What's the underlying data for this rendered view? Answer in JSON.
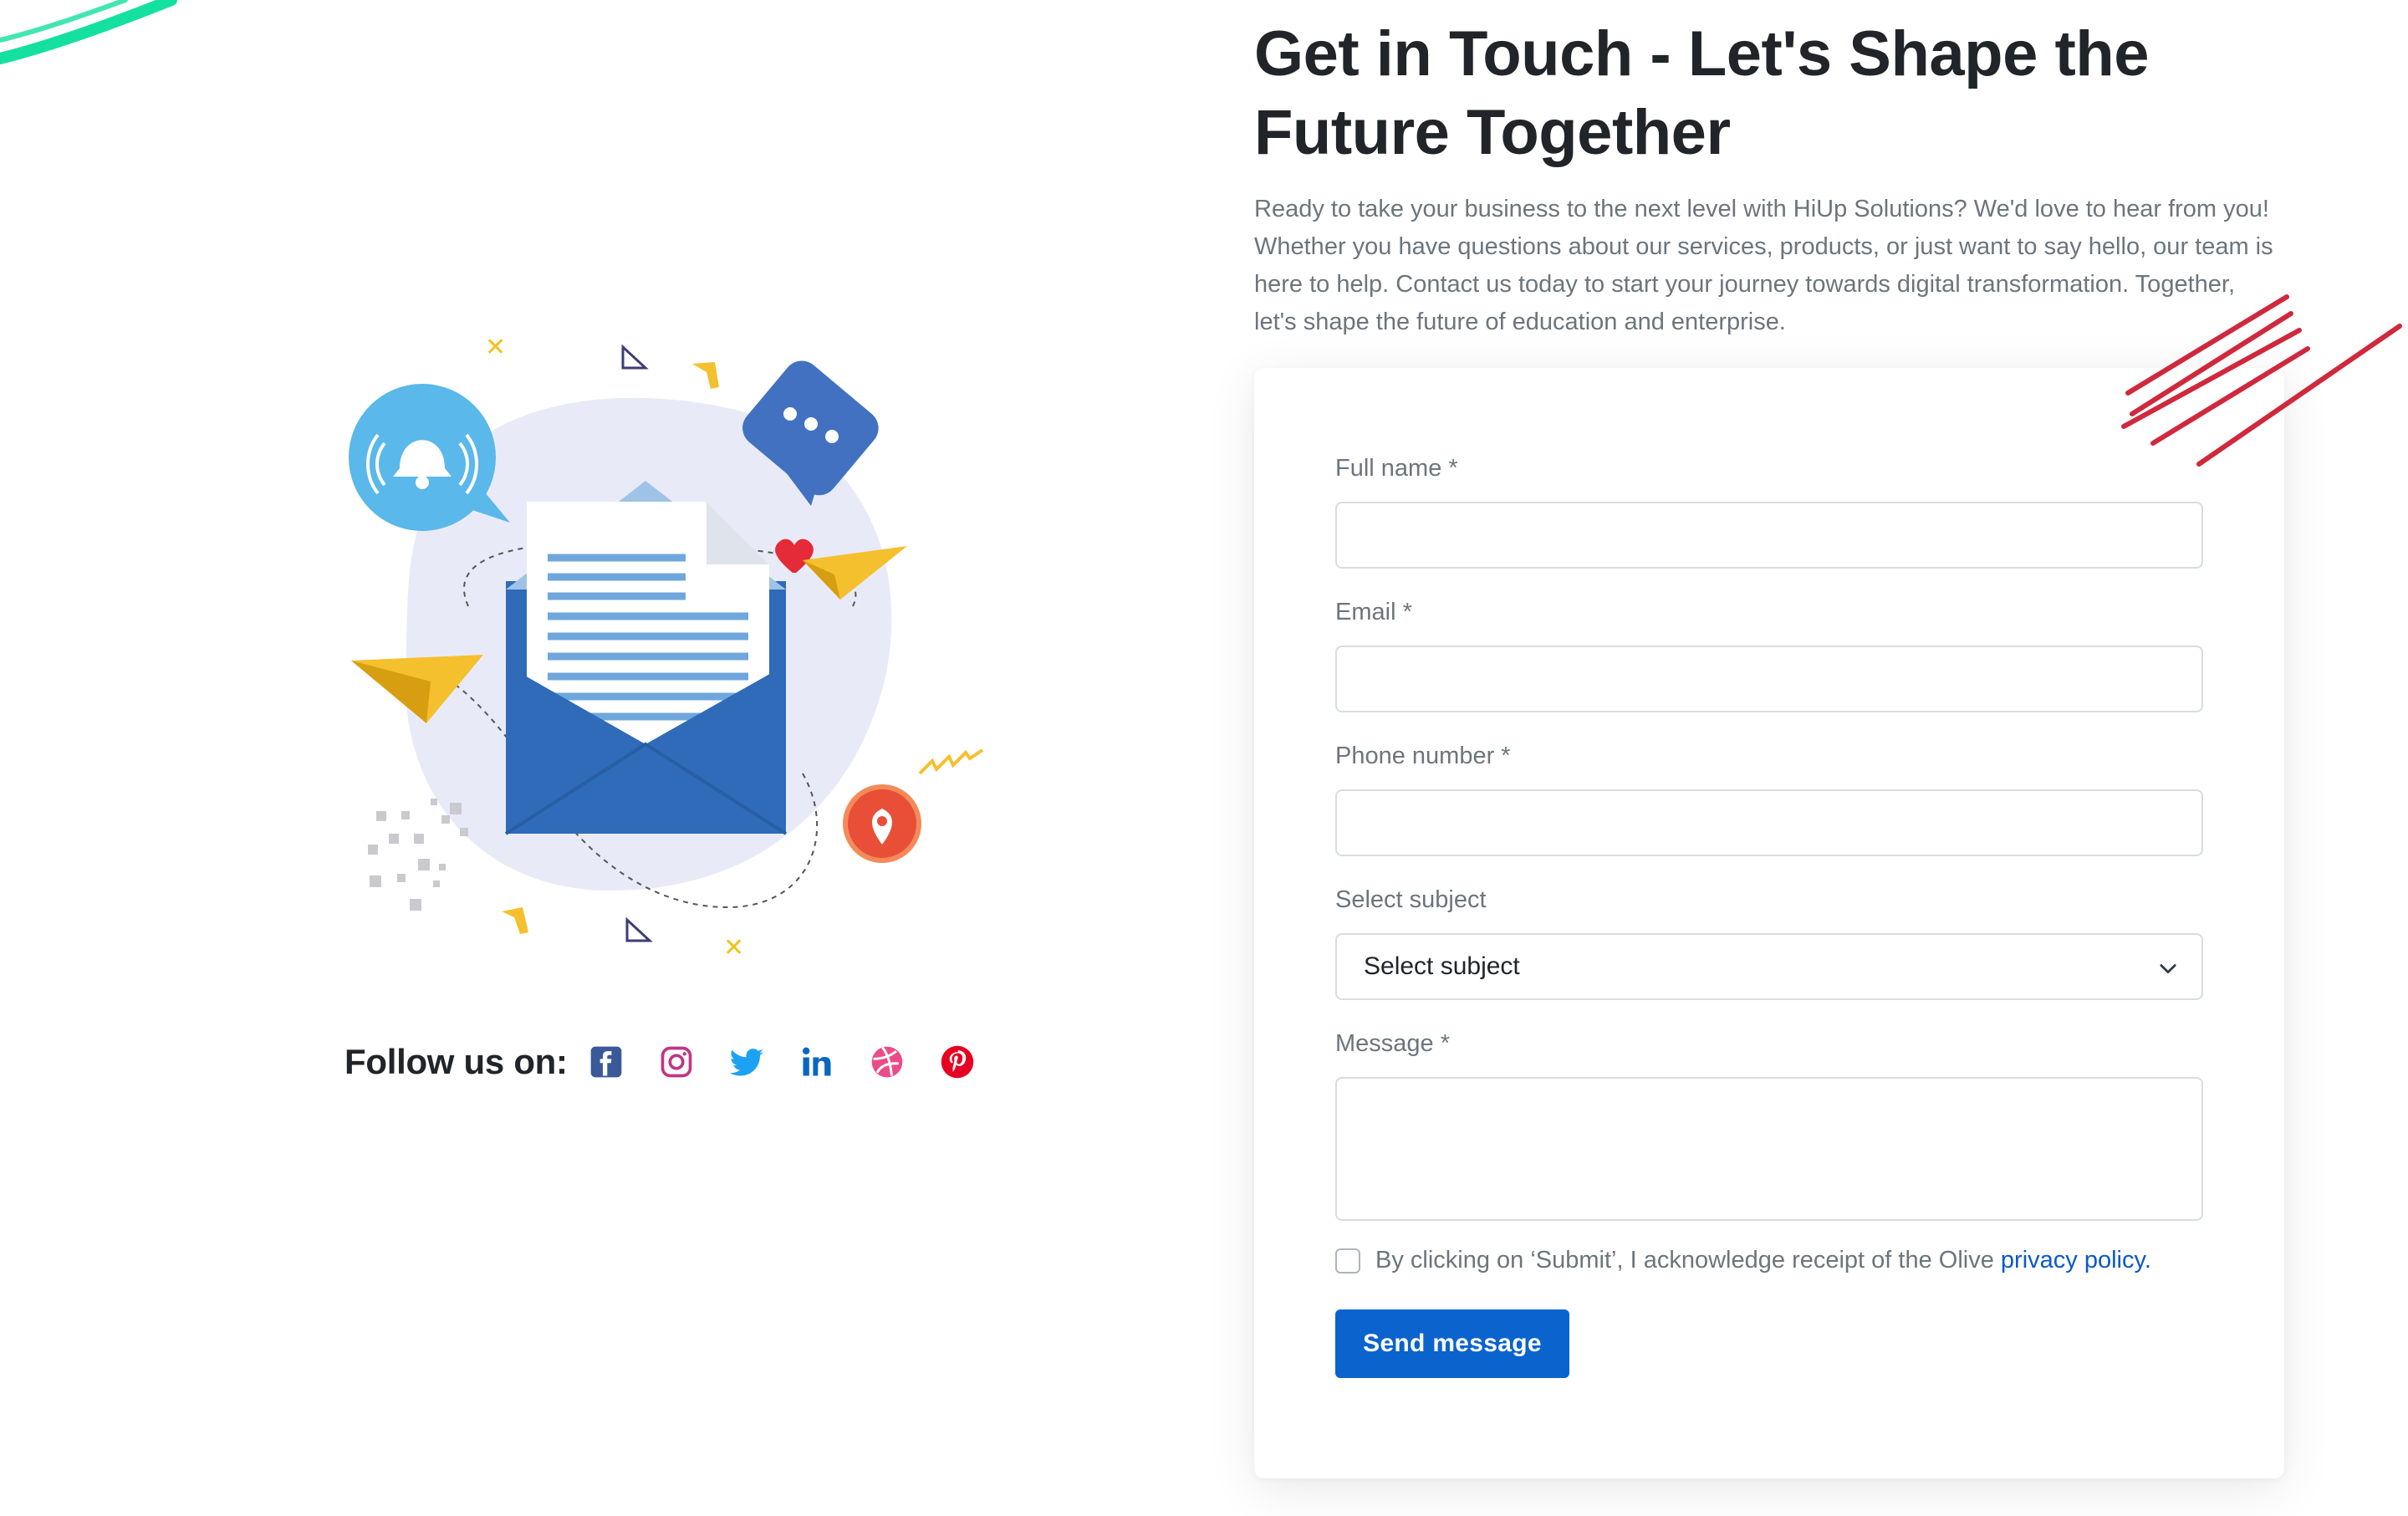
{
  "contact": {
    "title_line1": "Get in Touch - Let's Shape the",
    "title_line2": "Future Together",
    "intro": "Ready to take your business to the next level with HiUp Solutions? We'd love to hear from you! Whether you have questions about our services, products, or just want to say hello, our team is here to help. Contact us today to start your journey towards digital transformation. Together, let's shape the future of education and enterprise."
  },
  "form": {
    "full_name_label": "Full name *",
    "full_name_value": "",
    "email_label": "Email *",
    "email_value": "",
    "phone_label": "Phone number *",
    "phone_value": "",
    "subject_label": "Select subject",
    "subject_selected": "Select subject",
    "message_label": "Message *",
    "message_value": "",
    "consent_text": "By clicking on ‘Submit’, I acknowledge receipt of the Olive ",
    "privacy_link": "privacy policy",
    "consent_suffix": ".",
    "consent_checked": false,
    "submit_label": "Send message"
  },
  "social": {
    "label": "Follow us on:",
    "icons": [
      "facebook-icon",
      "instagram-icon",
      "twitter-icon",
      "linkedin-icon",
      "dribbble-icon",
      "pinterest-icon"
    ]
  },
  "colors": {
    "primary": "#0b63ce",
    "accent_green": "#14e0a0",
    "accent_red": "#d0283c",
    "envelope_blue": "#2f6bb8",
    "paper_plane_yellow": "#f5c02e"
  }
}
